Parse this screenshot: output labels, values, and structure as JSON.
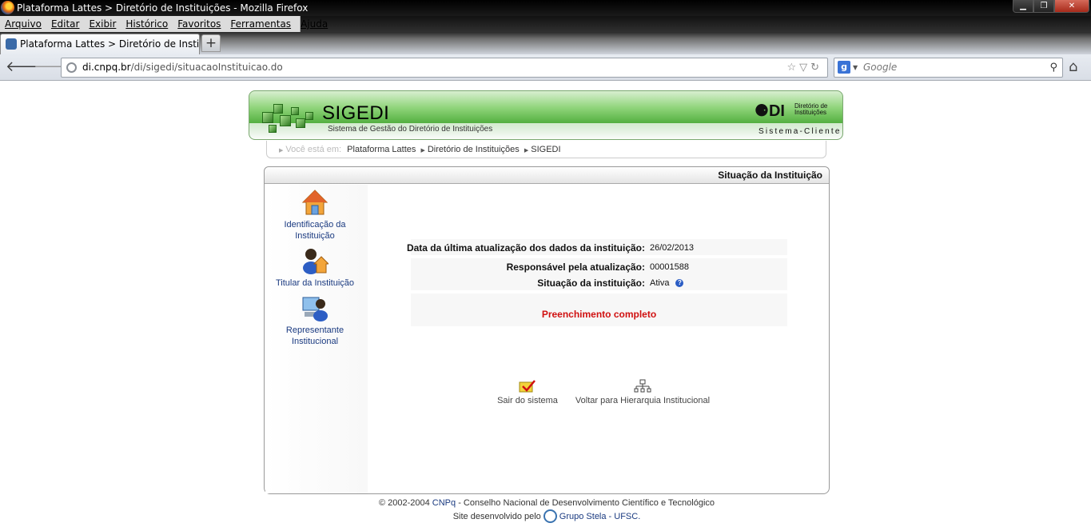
{
  "window": {
    "title": "Plataforma Lattes > Diretório de Instituições - Mozilla Firefox"
  },
  "menu": [
    "Arquivo",
    "Editar",
    "Exibir",
    "Histórico",
    "Favoritos",
    "Ferramentas",
    "Ajuda"
  ],
  "tab": {
    "label": "Plataforma Lattes > Diretório de Instituiç...",
    "new_tab": "+"
  },
  "nav": {
    "url_domain": "di.cnpq.br",
    "url_path": "/di/sigedi/situacaoInstituicao.do",
    "search_placeholder": "Google"
  },
  "header": {
    "system": "SIGEDI",
    "subtitle": "Sistema de Gestão do Diretório de Instituições",
    "di_logo": "DI",
    "di_label_1": "Diretório de",
    "di_label_2": "Instituições",
    "client": "Sistema-Cliente"
  },
  "breadcrumb": {
    "prefix": "Você está em:",
    "items": [
      "Plataforma Lattes",
      "Diretório de Instituições",
      "SIGEDI"
    ]
  },
  "panel": {
    "title": "Situação da Instituição"
  },
  "sidebar": [
    {
      "label": "Identificação da Instituição",
      "icon": "house-icon"
    },
    {
      "label": "Titular da Instituição",
      "icon": "user-house-icon"
    },
    {
      "label": "Representante Institucional",
      "icon": "user-computer-icon"
    }
  ],
  "info": {
    "last_update_label": "Data da última atualização dos dados da instituição:",
    "last_update_value": "26/02/2013",
    "responsible_label": "Responsável pela atualização:",
    "responsible_value": "00001588",
    "status_label": "Situação da instituição:",
    "status_value": "Ativa",
    "help": "?"
  },
  "completion": "Preenchimento completo",
  "actions": {
    "logout": "Sair do sistema",
    "hierarchy": "Voltar para Hierarquia Institucional"
  },
  "footer": {
    "line1_prefix": "© 2002-2004",
    "cnpq": "CNPq",
    "line1_suffix": "- Conselho Nacional de Desenvolvimento Científico e Tecnológico",
    "line2_prefix": "Site desenvolvido pelo",
    "stela": "Grupo Stela - UFSC."
  }
}
